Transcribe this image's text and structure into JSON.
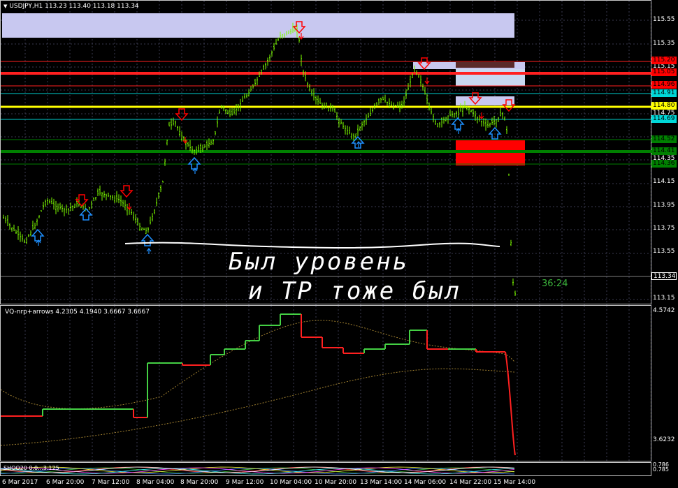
{
  "chart": {
    "symbol_header": "USDJPY,H1  113.23 113.40 113.18 113.34",
    "timer": "36:24",
    "annotation_line1": "Был уровень",
    "annotation_line2": "и TP тоже был",
    "indicator_header": "VQ-nrp+arrows 4.2305 4.1940 3.6667 3.6667",
    "sub_indicator_header": "SHOO20 0.0...3.125",
    "price_axis": [
      "115.55",
      "115.35",
      "115.15",
      "114.95",
      "114.75",
      "114.55",
      "114.35",
      "114.15",
      "113.95",
      "113.75",
      "113.55",
      "113.15"
    ],
    "price_boxes": [
      {
        "label": "115.20",
        "color": "#ff0000",
        "text": "#000000"
      },
      {
        "label": "115.05",
        "color": "#ff0000",
        "text": "#000000"
      },
      {
        "label": "114.96",
        "color": "#ff0000",
        "text": "#000000"
      },
      {
        "label": "114.91",
        "color": "#00d8d8",
        "text": "#000000"
      },
      {
        "label": "114.80",
        "color": "#ffff00",
        "text": "#000000"
      },
      {
        "label": "114.69",
        "color": "#00d8d8",
        "text": "#000000"
      },
      {
        "label": "114.52",
        "color": "#008000",
        "text": "#000000"
      },
      {
        "label": "114.41",
        "color": "#008000",
        "text": "#000000"
      },
      {
        "label": "114.36",
        "color": "#008000",
        "text": "#000000"
      },
      {
        "label": "113.34",
        "color": "#000000",
        "text": "#ffffff"
      }
    ],
    "indicator_axis_top": "4.5742",
    "indicator_axis_bottom": "3.6232",
    "sub_axis": [
      "0.786",
      "0.785"
    ],
    "time_axis": [
      "6 Mar 2017",
      "6 Mar 20:00",
      "7 Mar 12:00",
      "8 Mar 04:00",
      "8 Mar 20:00",
      "9 Mar 12:00",
      "10 Mar 04:00",
      "10 Mar 20:00",
      "13 Mar 14:00",
      "14 Mar 06:00",
      "14 Mar 22:00",
      "15 Mar 14:00"
    ],
    "colors": {
      "candle": "#7cfc00",
      "bear_arrow": "#ff0000",
      "bull_arrow": "#1e90ff",
      "resistance": "#ff0000",
      "pivot": "#ffff00",
      "support": "#008000",
      "zone_top": "#c8c8f0"
    }
  }
}
